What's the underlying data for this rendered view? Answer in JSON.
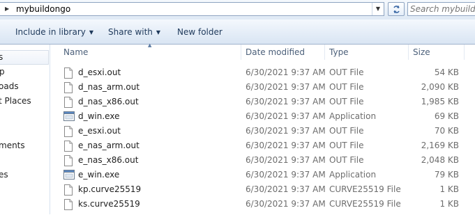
{
  "address": {
    "crumb": "mybuildongo"
  },
  "search": {
    "placeholder": "Search mybuildongo"
  },
  "toolbar": {
    "include": "Include in library",
    "share": "Share with",
    "newfolder": "New folder"
  },
  "nav": {
    "items": [
      "s",
      "p",
      "oads",
      "t Places",
      "ments",
      "es"
    ]
  },
  "columns": {
    "name": "Name",
    "date": "Date modified",
    "type": "Type",
    "size": "Size"
  },
  "files": [
    {
      "name": "d_esxi.out",
      "date": "6/30/2021 9:37 AM",
      "type": "OUT File",
      "size": "54 KB",
      "icon": "file-icon"
    },
    {
      "name": "d_nas_arm.out",
      "date": "6/30/2021 9:37 AM",
      "type": "OUT File",
      "size": "2,090 KB",
      "icon": "file-icon"
    },
    {
      "name": "d_nas_x86.out",
      "date": "6/30/2021 9:37 AM",
      "type": "OUT File",
      "size": "1,985 KB",
      "icon": "file-icon"
    },
    {
      "name": "d_win.exe",
      "date": "6/30/2021 9:37 AM",
      "type": "Application",
      "size": "69 KB",
      "icon": "application-icon"
    },
    {
      "name": "e_esxi.out",
      "date": "6/30/2021 9:37 AM",
      "type": "OUT File",
      "size": "70 KB",
      "icon": "file-icon"
    },
    {
      "name": "e_nas_arm.out",
      "date": "6/30/2021 9:37 AM",
      "type": "OUT File",
      "size": "2,169 KB",
      "icon": "file-icon"
    },
    {
      "name": "e_nas_x86.out",
      "date": "6/30/2021 9:37 AM",
      "type": "OUT File",
      "size": "2,048 KB",
      "icon": "file-icon"
    },
    {
      "name": "e_win.exe",
      "date": "6/30/2021 9:37 AM",
      "type": "Application",
      "size": "79 KB",
      "icon": "application-icon"
    },
    {
      "name": "kp.curve25519",
      "date": "6/30/2021 9:37 AM",
      "type": "CURVE25519 File",
      "size": "1 KB",
      "icon": "file-icon"
    },
    {
      "name": "ks.curve25519",
      "date": "6/30/2021 9:37 AM",
      "type": "CURVE25519 File",
      "size": "1 KB",
      "icon": "file-icon"
    }
  ]
}
